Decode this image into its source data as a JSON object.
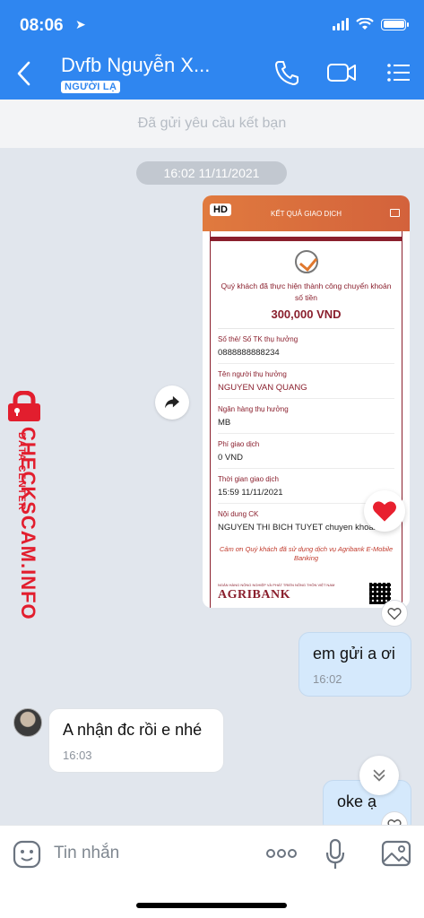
{
  "status_bar": {
    "time": "08:06"
  },
  "header": {
    "contact_name": "Dvfb Nguyễn X...",
    "badge": "NGƯỜI LẠ"
  },
  "friend_request": {
    "text": "Đã gửi yêu cầu kết bạn"
  },
  "chat": {
    "timestamp": "16:02 11/11/2021",
    "image_message": {
      "hd_badge": "HD",
      "receipt": {
        "header": "KẾT QUẢ GIAO DỊCH",
        "success_text": "Quý khách đã thực hiện thành công chuyển khoản số tiền",
        "amount": "300,000 VND",
        "fields": [
          {
            "label": "Số thẻ/ Số TK thụ hưởng",
            "value": "0888888888234"
          },
          {
            "label": "Tên người thụ hưởng",
            "value": "NGUYEN VAN QUANG"
          },
          {
            "label": "Ngân hàng thụ hưởng",
            "value": "MB"
          },
          {
            "label": "Phí giao dịch",
            "value": "0 VND"
          },
          {
            "label": "Thời gian giao dịch",
            "value": "15:59 11/11/2021"
          },
          {
            "label": "Nội dung CK",
            "value": "NGUYEN THI BICH TUYET chuyen khoan"
          }
        ],
        "thanks": "Cảm ơn Quý khách đã sử dụng dịch vụ Agribank E-Mobile Banking",
        "bank_small": "NGÂN HÀNG NÔNG NGHIỆP VÀ PHÁT TRIỂN NÔNG THÔN VIỆT NAM",
        "bank_name": "AGRIBANK"
      }
    },
    "messages": [
      {
        "direction": "out",
        "text": "em gửi a ơi",
        "time": "16:02"
      },
      {
        "direction": "in",
        "text": "A nhận đc rồi e nhé",
        "time": "16:03"
      },
      {
        "direction": "out",
        "text": "oke ạ"
      }
    ]
  },
  "watermark": {
    "main": "CHECKSCAM.INFO",
    "sub": "DATA CENTER"
  },
  "input_bar": {
    "placeholder": "Tin nhắn"
  },
  "colors": {
    "header_blue": "#2f86f0",
    "heart_red": "#e8202f",
    "agribank_maroon": "#8a1f2d"
  }
}
